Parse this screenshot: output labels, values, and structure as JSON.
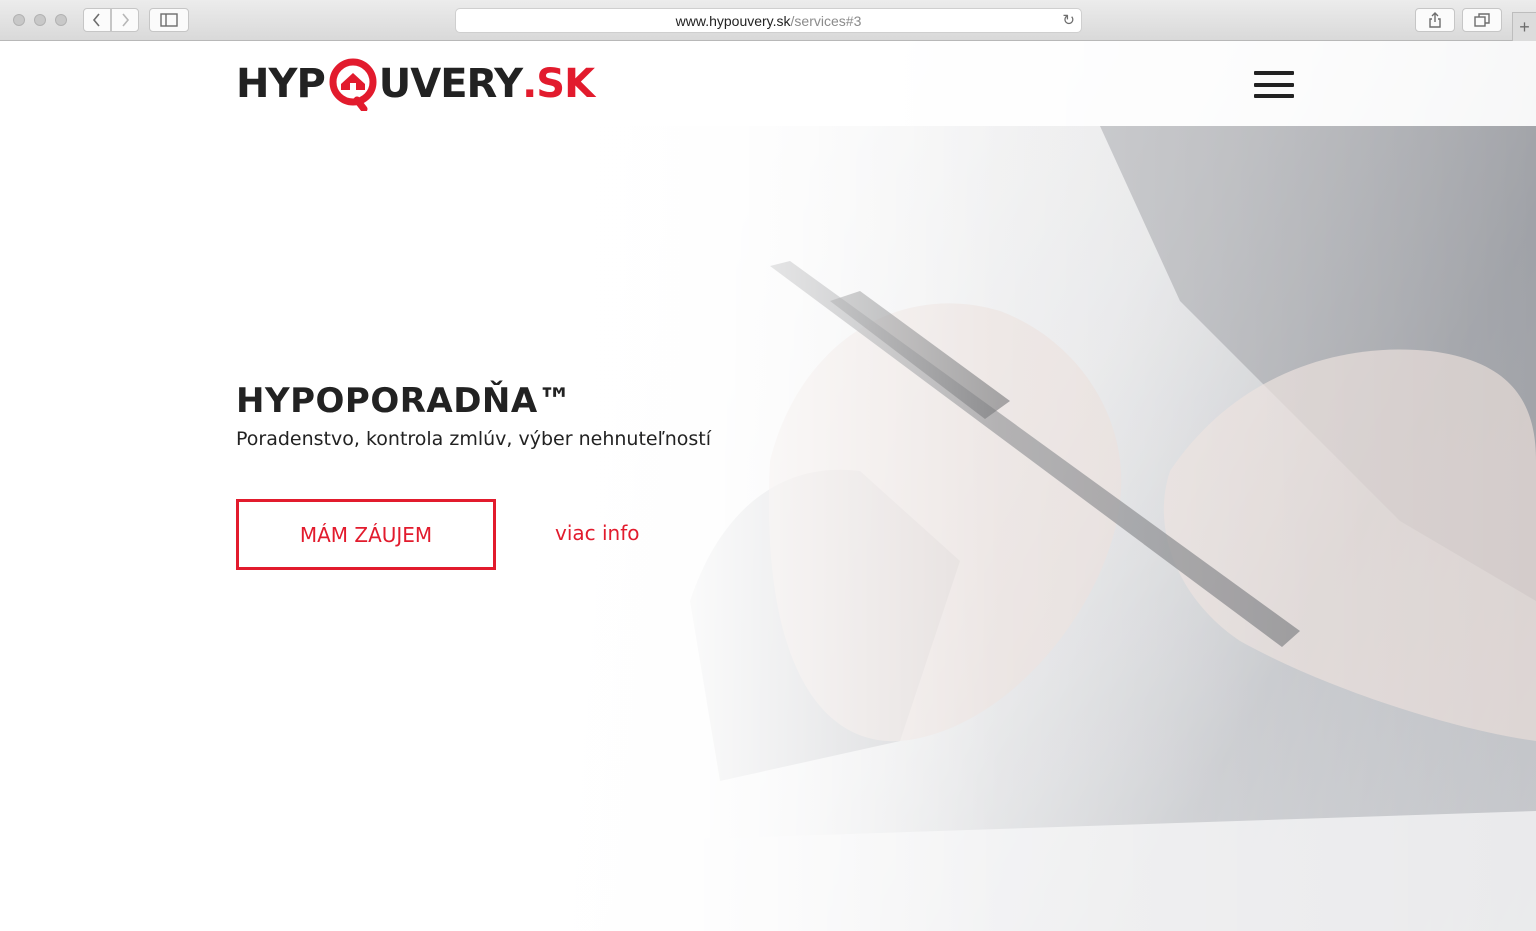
{
  "browser": {
    "url_domain": "www.hypouvery.sk",
    "url_path": "/services#3"
  },
  "logo": {
    "part1": "HYP",
    "part2": "UVERY",
    "part3": ".SK"
  },
  "hero": {
    "title": "HYPOPORADŇA™",
    "subtitle": "Poradenstvo, kontrola zmlúv, výber nehnuteľností",
    "cta_label": "MÁM ZÁUJEM",
    "more_label": "viac info"
  },
  "colors": {
    "accent": "#e21b2d",
    "text": "#222222"
  }
}
